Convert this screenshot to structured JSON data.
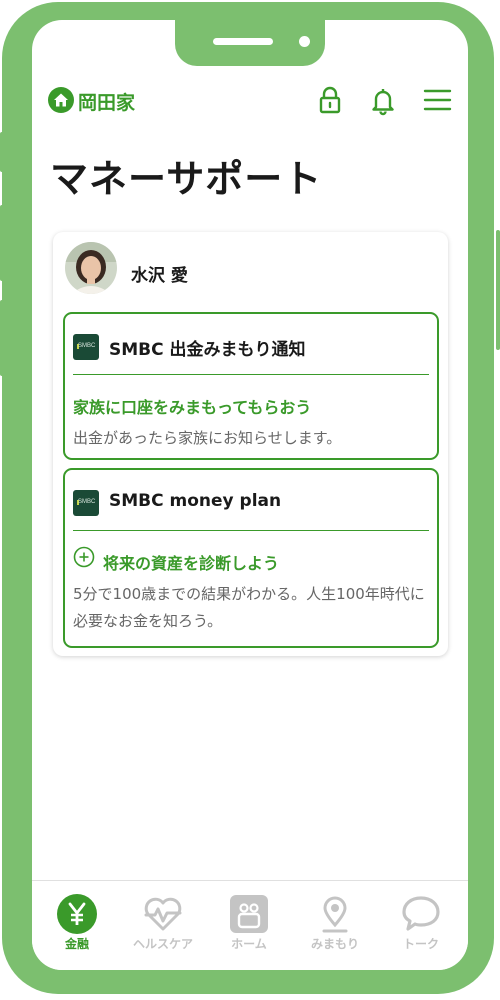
{
  "header": {
    "family_name": "岡田家",
    "icons": [
      "home-icon",
      "lock-icon",
      "bell-icon",
      "menu-icon"
    ]
  },
  "page": {
    "title": "マネーサポート"
  },
  "person": {
    "name": "水沢 愛"
  },
  "services": [
    {
      "logo_text": "SMBC",
      "title": "SMBC 出金みまもり通知",
      "link_label": "家族に口座をみまもってもらおう",
      "description": "出金があったら家族にお知らせします。"
    },
    {
      "logo_text": "SMBC",
      "title": "SMBC money plan",
      "link_label": "将来の資産を診断しよう",
      "link_icon": "plus-circle-icon",
      "description": "5分で100歳までの結果がわかる。人生100年時代に必要なお金を知ろう。"
    }
  ],
  "nav": {
    "items": [
      {
        "label": "金融",
        "icon": "yen-icon",
        "active": true
      },
      {
        "label": "ヘルスケア",
        "icon": "heart-pulse-icon",
        "active": false
      },
      {
        "label": "ホーム",
        "icon": "home-app-icon",
        "active": false
      },
      {
        "label": "みまもり",
        "icon": "location-pin-icon",
        "active": false
      },
      {
        "label": "トーク",
        "icon": "chat-bubble-icon",
        "active": false
      }
    ]
  },
  "colors": {
    "accent": "#3a9a2a",
    "frame": "#7cbf6f",
    "inactive": "#c4c4c4",
    "logo_bg": "#1a4a36"
  }
}
